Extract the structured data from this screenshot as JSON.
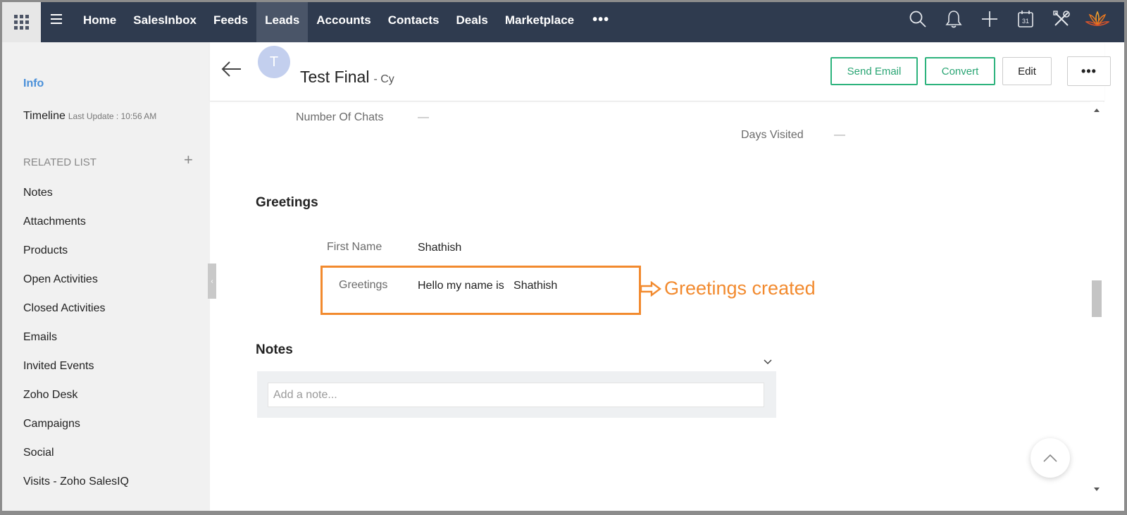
{
  "nav": {
    "items": [
      {
        "label": "Home",
        "active": false
      },
      {
        "label": "SalesInbox",
        "active": false
      },
      {
        "label": "Feeds",
        "active": false
      },
      {
        "label": "Leads",
        "active": true
      },
      {
        "label": "Accounts",
        "active": false
      },
      {
        "label": "Contacts",
        "active": false
      },
      {
        "label": "Deals",
        "active": false
      },
      {
        "label": "Marketplace",
        "active": false
      }
    ],
    "more_label": "•••",
    "icons": [
      "search-icon",
      "bell-icon",
      "plus-icon",
      "calendar-icon",
      "tools-icon",
      "lotus-icon"
    ],
    "calendar_day": "31"
  },
  "sidebar": {
    "info": "Info",
    "timeline": "Timeline",
    "last_update": "Last Update : 10:56 AM",
    "related_list": "RELATED LIST",
    "add": "+",
    "items": [
      "Notes",
      "Attachments",
      "Products",
      "Open Activities",
      "Closed Activities",
      "Emails",
      "Invited Events",
      "Zoho Desk",
      "Campaigns",
      "Social",
      "Visits - Zoho SalesIQ"
    ]
  },
  "record": {
    "avatar_letter": "T",
    "name": "Test Final",
    "sub": "- Cy",
    "buttons": {
      "send_email": "Send Email",
      "convert": "Convert",
      "edit": "Edit",
      "more": "•••"
    }
  },
  "fields": {
    "number_of_chats": {
      "label": "Number Of Chats",
      "value": "—"
    },
    "days_visited": {
      "label": "Days Visited",
      "value": "—"
    }
  },
  "greetings": {
    "title": "Greetings",
    "first_name_label": "First Name",
    "first_name_value": "Shathish",
    "greetings_label": "Greetings",
    "greetings_value": "Hello my name is   Shathish",
    "annotation": "Greetings created"
  },
  "notes": {
    "title": "Notes",
    "placeholder": "Add a note..."
  },
  "colors": {
    "nav_bg": "#2f3b4f",
    "accent_green": "#2db37d",
    "annotation_orange": "#f28a2e",
    "link_blue": "#4a90d9"
  }
}
